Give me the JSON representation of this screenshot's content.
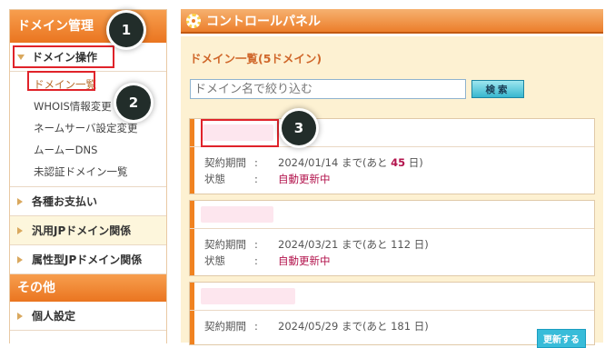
{
  "sidebar": {
    "header": "ドメイン管理",
    "domain_ops": {
      "label": "ドメイン操作",
      "items": [
        "ドメイン一覧",
        "WHOIS情報変更",
        "ネームサーバ設定変更",
        "ムームーDNS",
        "未認証ドメイン一覧"
      ]
    },
    "sections": [
      "各種お支払い",
      "汎用JPドメイン関係",
      "属性型JPドメイン関係"
    ],
    "other_header": "その他",
    "other_items": [
      "個人設定"
    ]
  },
  "control_panel": {
    "title": "コントロールパネル"
  },
  "main": {
    "title": "ドメイン一覧(5ドメイン)",
    "filter_placeholder": "ドメイン名で絞り込む",
    "search_label": "検索",
    "renew_label": "更新する"
  },
  "domains": [
    {
      "period_label": "契約期間",
      "colon": ":",
      "date": "2024/01/14",
      "until": "まで",
      "remain_open": "(あと",
      "days": "45",
      "remain_close": "日)",
      "status_label": "状態",
      "status": "自動更新中"
    },
    {
      "period_label": "契約期間",
      "colon": ":",
      "date": "2024/03/21",
      "until": "まで",
      "remain_open": "(あと",
      "days": "112",
      "remain_close": "日)",
      "status_label": "状態",
      "status": "自動更新中"
    },
    {
      "period_label": "契約期間",
      "colon": ":",
      "date": "2024/05/29",
      "until": "まで",
      "remain_open": "(あと",
      "days": "181",
      "remain_close": "日)"
    }
  ],
  "annotations": [
    "1",
    "2",
    "3"
  ],
  "colors": {
    "accent": "#ec7e2b",
    "highlight": "#e0232a",
    "badge": "#222d2a",
    "status": "#b3144d"
  }
}
